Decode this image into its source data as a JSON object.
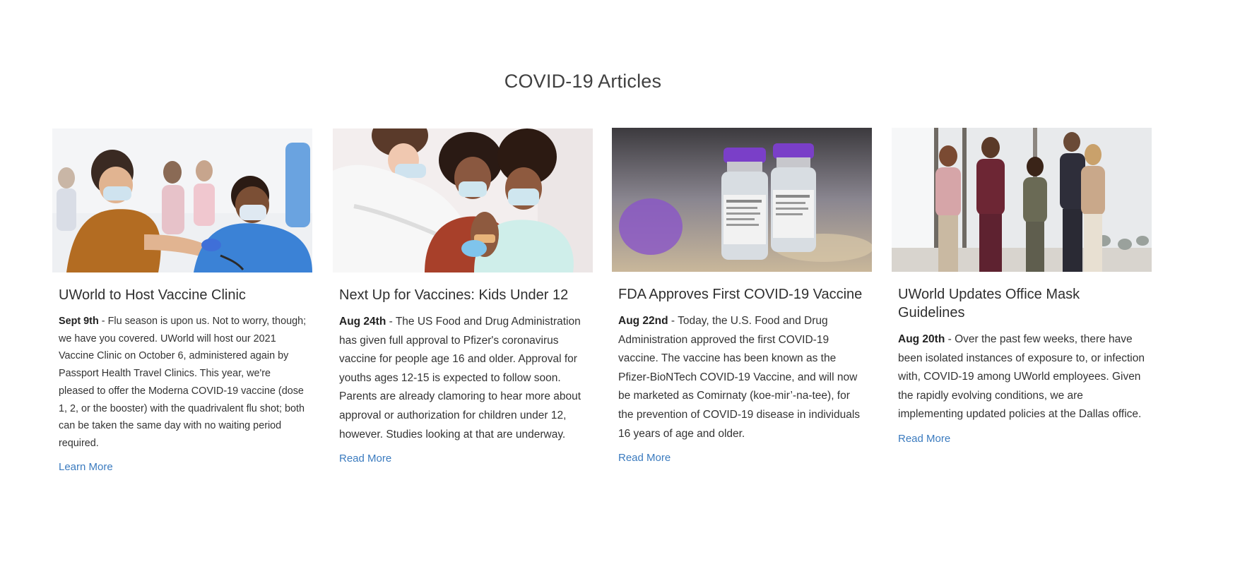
{
  "section": {
    "title": "COVID-19 Articles"
  },
  "articles": [
    {
      "image_desc_icon": "vaccination-photo",
      "title": "UWorld to Host Vaccine Clinic",
      "date": "Sept 9th",
      "separator": " - ",
      "text": "Flu season is upon us. Not to worry, though; we have you covered. UWorld will host our 2021 Vaccine Clinic on October 6, administered again by Passport Health Travel Clinics. This year, we're pleased to offer the Moderna COVID-19 vaccine (dose 1, 2, or the booster) with the quadrivalent flu shot; both can be taken the same day with no waiting period required.",
      "link": "Learn More"
    },
    {
      "image_desc_icon": "child-vaccination-photo",
      "title": "Next Up for Vaccines: Kids Under 12",
      "date": "Aug 24th",
      "separator": " - ",
      "text": "The US Food and Drug Administration has given full approval to Pfizer's coronavirus vaccine for people age 16 and older. Approval for youths ages 12-15 is expected to follow soon. Parents are already clamoring to hear more about approval or authorization for children under 12, however. Studies looking at that are underway.",
      "link": "Read More"
    },
    {
      "image_desc_icon": "vaccine-vials-photo",
      "title": "FDA Approves First COVID-19 Vaccine",
      "date": "Aug 22nd",
      "separator": " - ",
      "text": "Today, the U.S. Food and Drug Administration approved the first COVID-19 vaccine. The vaccine has been known as the Pfizer-BioNTech COVID-19 Vaccine, and will now be marketed as Comirnaty (koe-mir’-na-tee), for the prevention of COVID-19 disease in individuals 16 years of age and older.",
      "link": "Read More"
    },
    {
      "image_desc_icon": "office-masks-photo",
      "title": "UWorld Updates Office Mask Guidelines",
      "date": "Aug 20th",
      "separator": " - ",
      "text": "Over the past few weeks, there have been isolated instances of exposure to, or infection with, COVID-19 among UWorld employees. Given the rapidly evolving conditions, we are implementing updated policies at the Dallas office.",
      "link": "Read More"
    }
  ],
  "colors": {
    "link": "#3b7bbf",
    "title": "#404040",
    "text": "#333333"
  }
}
